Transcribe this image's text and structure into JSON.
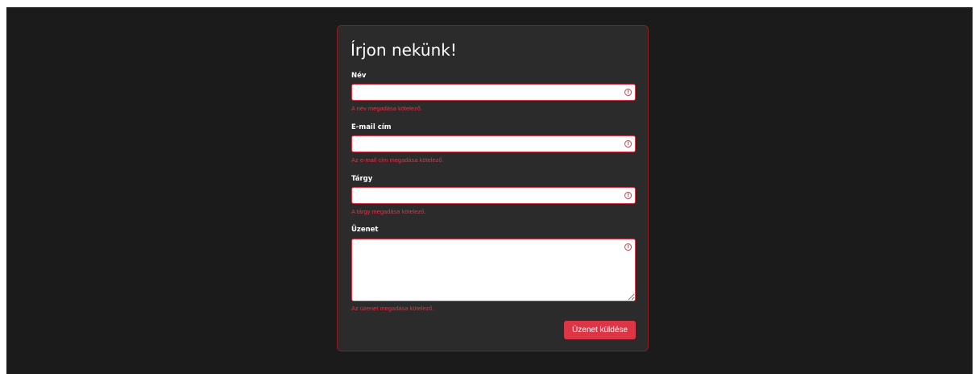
{
  "form": {
    "title": "Írjon nekünk!",
    "fields": [
      {
        "label": "Név",
        "value": "",
        "error": "A név megadása kötelező."
      },
      {
        "label": "E-mail cím",
        "value": "",
        "error": "Az e-mail cím megadása kötelező."
      },
      {
        "label": "Tárgy",
        "value": "",
        "error": "A tárgy megadása kötelező."
      },
      {
        "label": "Üzenet",
        "value": "",
        "error": "Az üzenet megadása kötelező."
      }
    ],
    "invalid_icon": "!",
    "submit_label": "Üzenet küldése"
  },
  "colors": {
    "page_background": "#1b1b1b",
    "card_background": "#2b2b2b",
    "card_border": "#8a1c24",
    "error": "#dc3545",
    "button": "#dc3545",
    "text": "#ffffff"
  },
  "icons": {
    "invalid_field": "exclamation-circle-icon"
  }
}
